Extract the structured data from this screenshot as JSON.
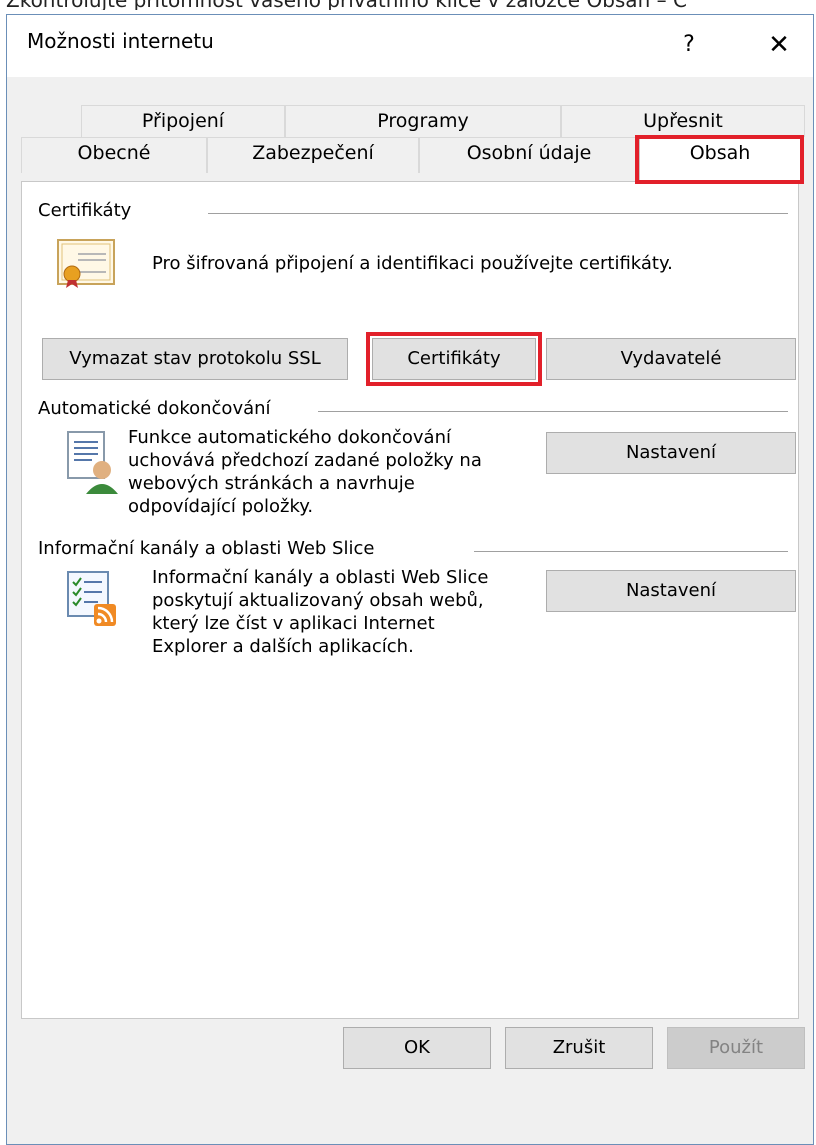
{
  "page_top_text": "Zkontrolujte přítomnost vašeho privátního klíče v záložce Obsah – C",
  "dialog": {
    "title": "Možnosti internetu",
    "help_label": "?",
    "close_label": "✕"
  },
  "tabs": {
    "row1": [
      "Připojení",
      "Programy",
      "Upřesnit"
    ],
    "row2": [
      "Obecné",
      "Zabezpečení",
      "Osobní údaje",
      "Obsah"
    ],
    "active": "Obsah"
  },
  "certificates": {
    "title": "Certifikáty",
    "description": "Pro šifrovaná připojení a identifikaci používejte certifikáty.",
    "buttons": {
      "clear_ssl": "Vymazat stav protokolu SSL",
      "certificates": "Certifikáty",
      "publishers": "Vydavatelé"
    }
  },
  "autocomplete": {
    "title": "Automatické dokončování",
    "description": [
      "Funkce automatického dokončování",
      "uchovává předchozí zadané položky na",
      "webových stránkách a navrhuje",
      "odpovídající položky."
    ],
    "settings_button": "Nastavení"
  },
  "feeds": {
    "title": "Informační kanály a oblasti Web Slice",
    "description": [
      "Informační kanály a oblasti Web Slice",
      "poskytují aktualizovaný obsah webů,",
      "který lze číst v aplikaci Internet",
      "Explorer a dalších aplikacích."
    ],
    "settings_button": "Nastavení"
  },
  "footer": {
    "ok": "OK",
    "cancel": "Zrušit",
    "apply": "Použít"
  },
  "colors": {
    "highlight": "#e2202a",
    "dialog_border": "#6b8fb8",
    "client_bg": "#f0f0f0"
  }
}
